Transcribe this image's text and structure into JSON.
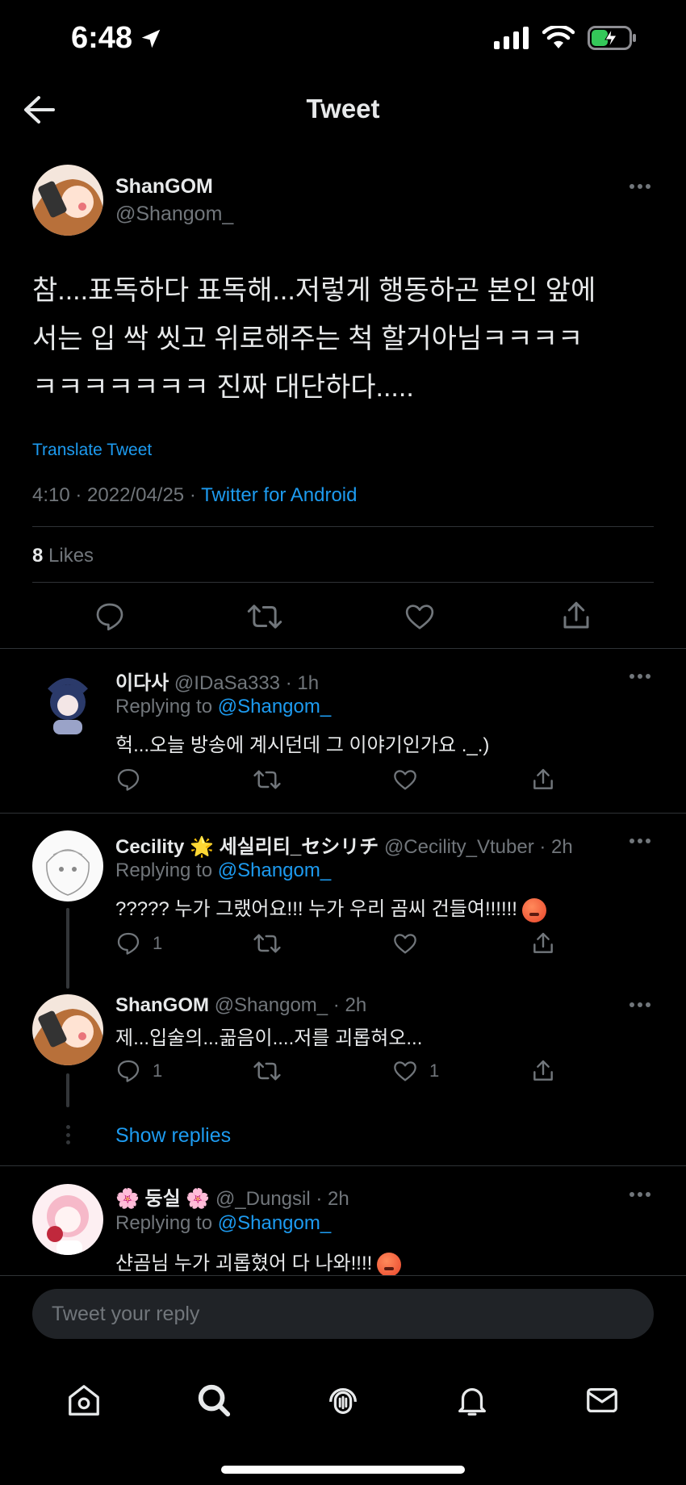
{
  "status_bar": {
    "time": "6:48"
  },
  "header": {
    "title": "Tweet"
  },
  "main_tweet": {
    "display_name": "ShanGOM",
    "handle": "@Shangom_",
    "text_line1": "참....표독하다 표독해...저렇게 행동하곤 본인 앞에",
    "text_line2": "서는 입 싹 씻고 위로해주는 척 할거아님ㅋㅋㅋㅋ",
    "text_line3": "ㅋㅋㅋㅋㅋㅋㅋ 진짜 대단하다.....",
    "translate_label": "Translate Tweet",
    "time_date": "4:10 · 2022/04/25 · ",
    "source": "Twitter for Android",
    "likes_count": "8",
    "likes_label": "Likes"
  },
  "replies": [
    {
      "display_name": "이다사",
      "meta": "@IDaSa333 · 1h",
      "replying_prefix": "Replying to ",
      "replying_to": "@Shangom_",
      "text": "헉...오늘 방송에 계시던데 그 이야기인가요 ._.)",
      "reply_count": "",
      "like_count": ""
    },
    {
      "display_name": "Cecility 🌟 세실리티_セシリチ",
      "meta": "@Cecility_Vtuber · 2h",
      "replying_prefix": "Replying to ",
      "replying_to": "@Shangom_",
      "text": "????? 누가 그랬어요!!! 누가 우리 곰씨 건들여!!!!!!",
      "reply_count": "1",
      "like_count": ""
    },
    {
      "display_name": "ShanGOM",
      "meta": "@Shangom_ · 2h",
      "text": "제...입술의...곪음이....저를 괴롭혀오...",
      "reply_count": "1",
      "like_count": "1"
    },
    {
      "display_name": "🌸 둥실 🌸",
      "meta": "@_Dungsil · 2h",
      "replying_prefix": "Replying to ",
      "replying_to": "@Shangom_",
      "text": "샨곰님 누가 괴롭혔어 다 나와!!!!"
    }
  ],
  "show_replies_label": "Show replies",
  "composer": {
    "placeholder": "Tweet your reply"
  },
  "colors": {
    "accent": "#1d9bf0",
    "background": "#000000",
    "muted": "#71767b",
    "divider": "#2f3336",
    "battery": "#34c759"
  },
  "icons": [
    "location-arrow-icon",
    "signal-icon",
    "wifi-icon",
    "battery-icon",
    "back-arrow-icon",
    "more-icon",
    "reply-icon",
    "retweet-icon",
    "like-icon",
    "share-icon",
    "home-icon",
    "search-icon",
    "spaces-icon",
    "notifications-icon",
    "messages-icon"
  ]
}
